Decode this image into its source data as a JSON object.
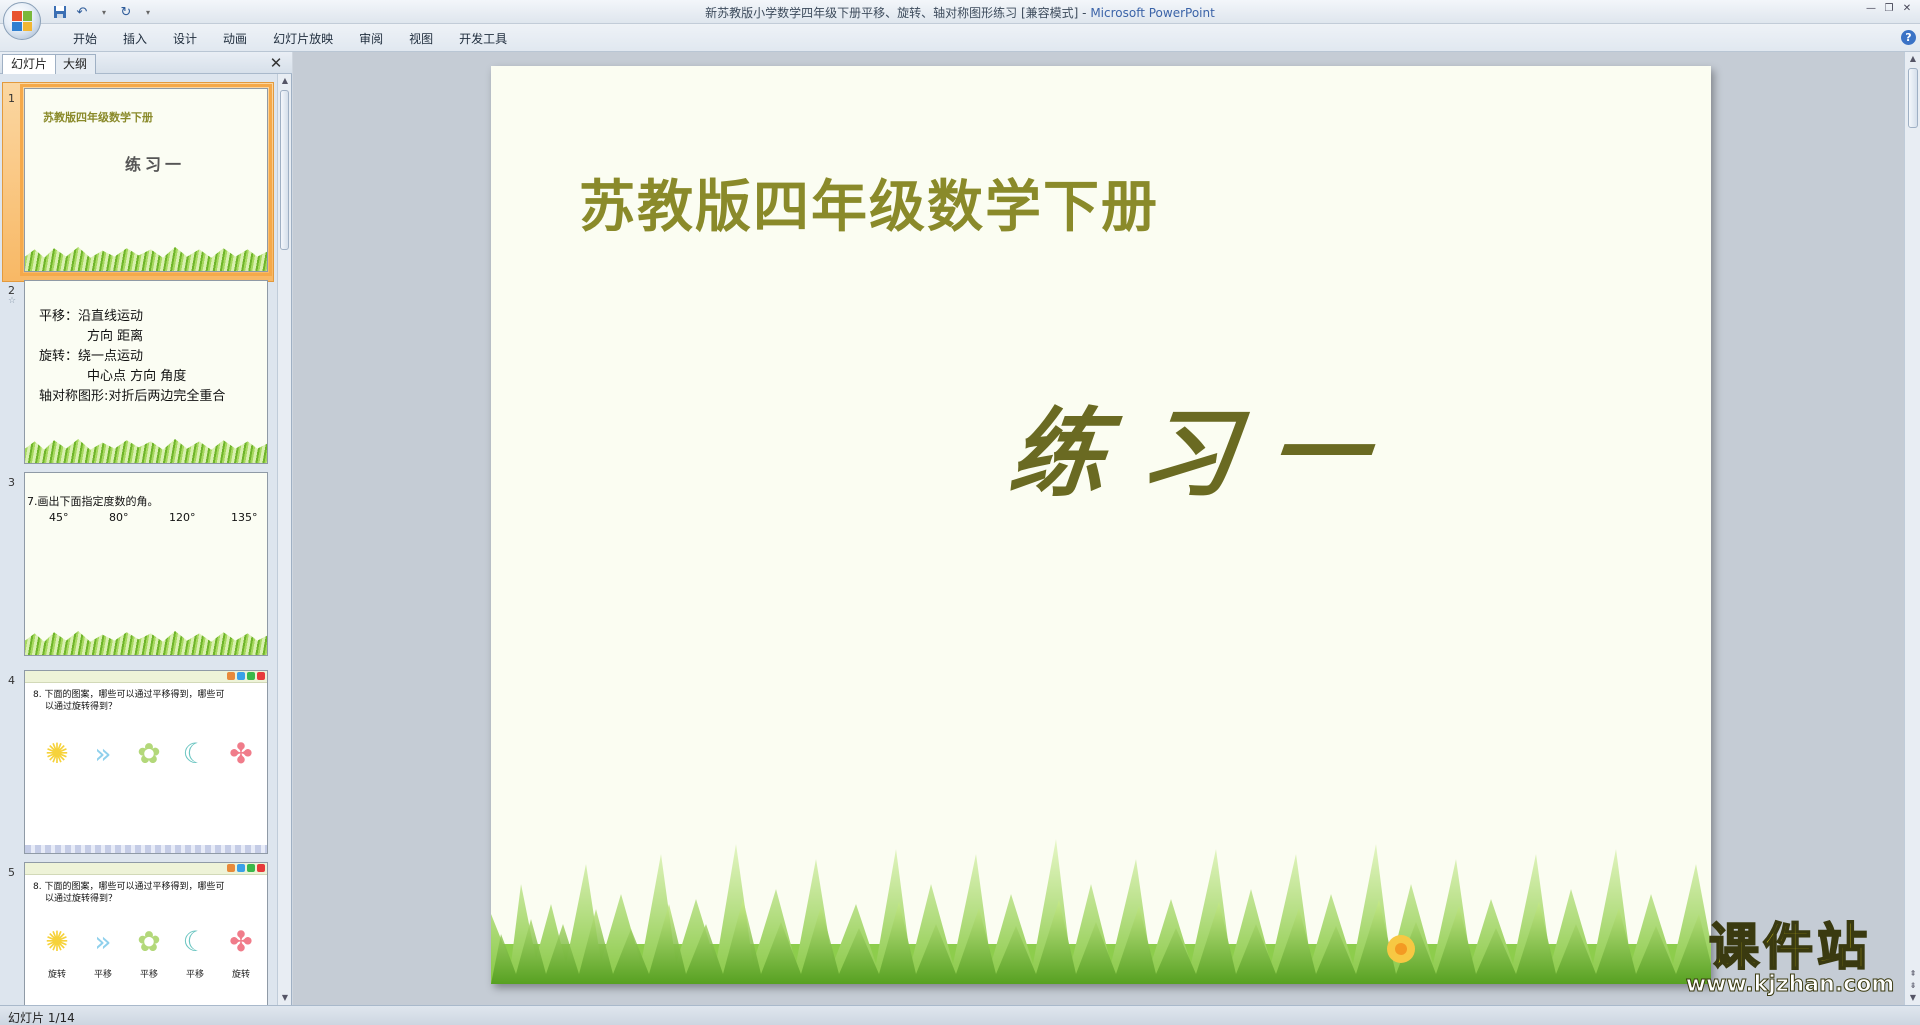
{
  "window": {
    "title": "新苏教版小学数学四年级下册平移、旋转、轴对称图形练习 [兼容模式] - ",
    "app_name": "Microsoft PowerPoint"
  },
  "ribbon": {
    "tabs": [
      "开始",
      "插入",
      "设计",
      "动画",
      "幻灯片放映",
      "审阅",
      "视图",
      "开发工具"
    ]
  },
  "left_pane": {
    "tabs": [
      "幻灯片",
      "大纲"
    ],
    "slides": [
      {
        "number": "1",
        "title": "苏教版四年级数学下册",
        "subtitle": "练习一"
      },
      {
        "number": "2",
        "lines": [
          "平移：沿直线运动",
          "方向 距离",
          "旋转：绕一点运动",
          "中心点 方向 角度",
          "轴对称图形:对折后两边完全重合"
        ]
      },
      {
        "number": "3",
        "heading": "7.画出下面指定度数的角。",
        "angles": [
          "45°",
          "80°",
          "120°",
          "135°"
        ]
      },
      {
        "number": "4",
        "heading_line1": "8. 下面的图案，哪些可以通过平移得到，哪些可",
        "heading_line2": "以通过旋转得到？"
      },
      {
        "number": "5",
        "heading_line1": "8. 下面的图案，哪些可以通过平移得到，哪些可",
        "heading_line2": "以通过旋转得到？",
        "labels": [
          "旋转",
          "平移",
          "平移",
          "平移",
          "旋转"
        ]
      }
    ]
  },
  "slide": {
    "title": "苏教版四年级数学下册",
    "subtitle": "练习一"
  },
  "watermark": {
    "brand": "课件站",
    "url": "www.kjzhan.com"
  },
  "status": {
    "slide_indicator": "幻灯片 1/14"
  },
  "colors": {
    "slide_bg": "#fbfdf2",
    "title_color": "#8a8a2a",
    "selection": "#f8b865"
  }
}
